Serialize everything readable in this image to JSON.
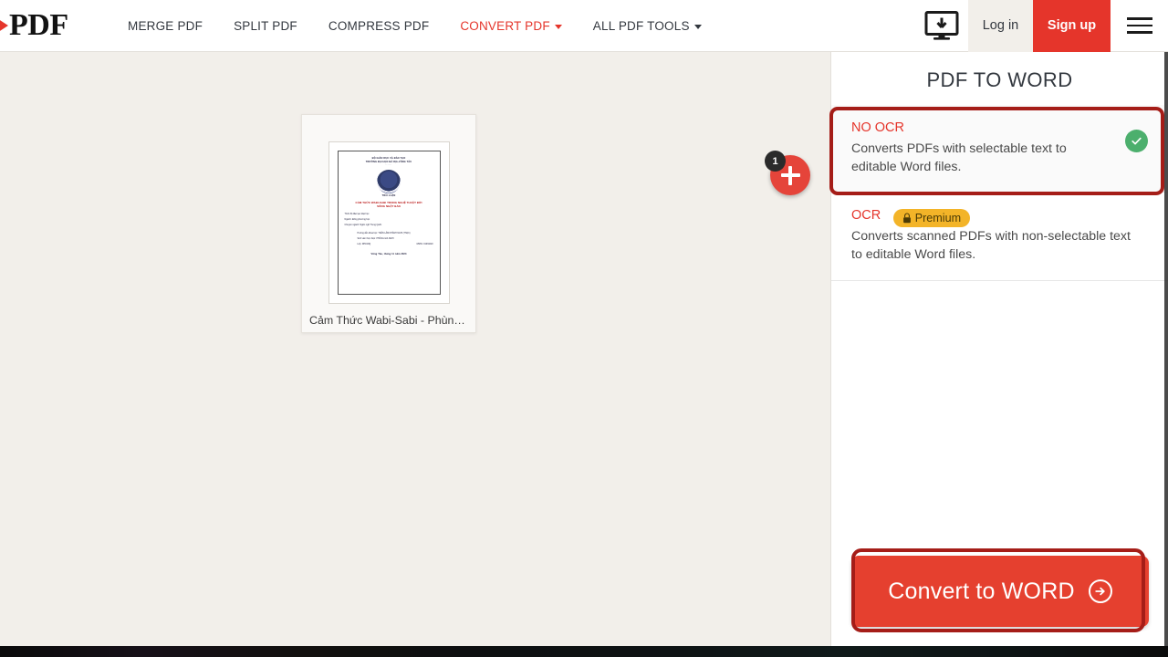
{
  "header": {
    "logo": {
      "text": "PDF",
      "icon": "play-arrow-icon"
    },
    "nav": [
      {
        "label": "MERGE PDF",
        "active": false,
        "has_caret": false
      },
      {
        "label": "SPLIT PDF",
        "active": false,
        "has_caret": false
      },
      {
        "label": "COMPRESS PDF",
        "active": false,
        "has_caret": false
      },
      {
        "label": "CONVERT PDF",
        "active": true,
        "has_caret": true
      },
      {
        "label": "ALL PDF TOOLS",
        "active": false,
        "has_caret": true
      }
    ],
    "desktop_icon": "monitor-download-icon",
    "login_label": "Log in",
    "signup_label": "Sign up",
    "menu_icon": "hamburger-menu-icon"
  },
  "workarea": {
    "file": {
      "name": "Cảm Thức Wabi-Sabi - Phùng ..",
      "thumbnail": {
        "header1": "BỘ GIÁO DỤC VÀ ĐÀO TẠO",
        "header2": "TRƯỜNG ĐẠI HỌC BÀ RỊA-VŨNG TÀU",
        "dots": "......",
        "seal": "university-seal-icon",
        "doc_type": "TIỂU LUẬN",
        "title_line1": "CẢM THỨC WABI-SABI TRONG NGHỆ THUẬT ĐỜI",
        "title_line2": "SỐNG NHẬT BẢN",
        "meta1": "Trình độ đào tạo: Đại học",
        "meta2": "Ngành: Đông phương học",
        "meta3": "Chuyên ngành: Ngôn ngữ Trung Quốc",
        "meta4": "Hướng dẫn khoa học: TRẦN LÂM KHÁNH NGHI (THẠC)",
        "meta5": "Sinh viên thực hiện: PHÙNG GIA NGHI",
        "meta6": "Lớp: DH19NQ",
        "meta7": "MSSV: 19031620",
        "footer": "Vũng Tàu, tháng 11 năm 2023"
      }
    },
    "add_file_button": {
      "icon": "plus-icon",
      "badge_count": "1"
    }
  },
  "panel": {
    "title": "PDF TO WORD",
    "options": [
      {
        "label": "NO OCR",
        "description": "Converts PDFs with selectable text to editable Word files.",
        "selected": true,
        "badge": null,
        "check_icon": "check-circle-icon"
      },
      {
        "label": "OCR",
        "description": "Converts scanned PDFs with non-selectable text to editable Word files.",
        "selected": false,
        "badge": {
          "label": "Premium",
          "icon": "lock-icon"
        },
        "check_icon": null
      }
    ],
    "convert_button": {
      "label": "Convert to WORD",
      "icon": "arrow-right-circle-icon"
    }
  },
  "colors": {
    "brand_red": "#e5352b",
    "button_red": "#e5402f",
    "annotation_red": "#a51d18",
    "premium_yellow": "#f3b428",
    "check_green": "#4caf6d",
    "canvas_bg": "#f2efea"
  }
}
